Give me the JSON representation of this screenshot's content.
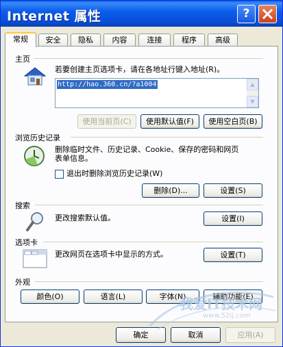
{
  "window": {
    "title": "Internet 属性",
    "help_label": "?",
    "close_label": "✕"
  },
  "tabs": [
    {
      "label": "常规",
      "active": true
    },
    {
      "label": "安全"
    },
    {
      "label": "隐私"
    },
    {
      "label": "内容"
    },
    {
      "label": "连接"
    },
    {
      "label": "程序"
    },
    {
      "label": "高级"
    }
  ],
  "home": {
    "title": "主页",
    "description": "若要创建主页选项卡，请在各地址行键入地址(R)。",
    "url": "http://hao.360.cn/?a1004",
    "use_current": "使用当前页(C)",
    "use_default": "使用默认值(F)",
    "use_blank": "使用空白页(B)"
  },
  "history": {
    "title": "浏览历史记录",
    "description_line1": "删除临时文件、历史记录、Cookie、保存的密码和网页",
    "description_line2": "表单信息。",
    "checkbox_label": "退出时删除浏览历史记录(W)",
    "delete": "删除(D)...",
    "settings": "设置(S)"
  },
  "search": {
    "title": "搜索",
    "description": "更改搜索默认值。",
    "settings": "设置(I)"
  },
  "tabs_section": {
    "title": "选项卡",
    "description": "更改网页在选项卡中显示的方式。",
    "settings": "设置(T)"
  },
  "appearance": {
    "title": "外观",
    "colors": "颜色(O)",
    "languages": "语言(L)",
    "fonts": "字体(N)",
    "accessibility": "辅助功能(E)"
  },
  "footer": {
    "ok": "确定",
    "cancel": "取消",
    "apply": "应用(A)"
  },
  "watermark": {
    "text": "我爱IT技术网",
    "url": "www.52ij.com"
  }
}
